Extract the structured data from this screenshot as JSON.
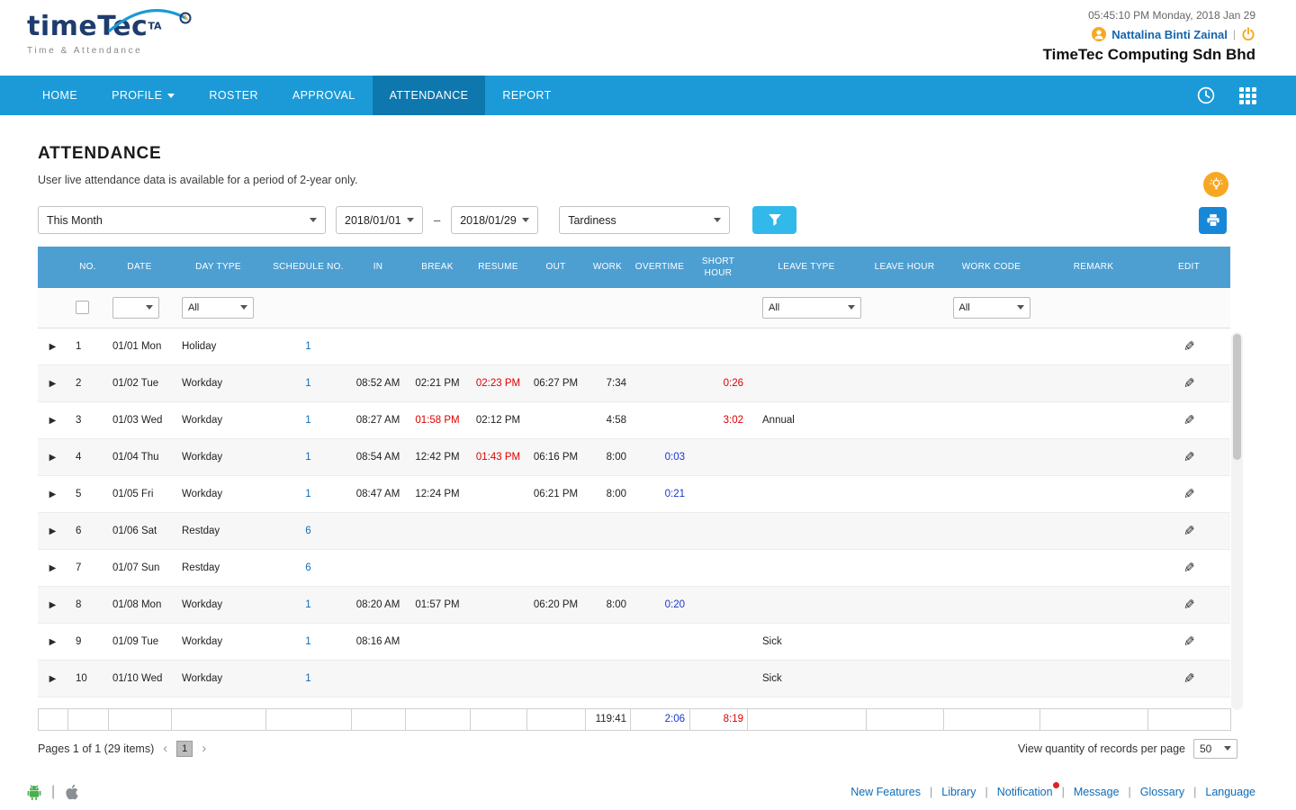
{
  "header": {
    "logo": {
      "brand": "timeTec",
      "suffix": "TA",
      "tagline": "Time & Attendance"
    },
    "datetime": "05:45:10 PM Monday, 2018 Jan 29",
    "user_name": "Nattalina Binti Zainal",
    "company": "TimeTec Computing Sdn Bhd"
  },
  "nav": {
    "home": "HOME",
    "profile": "PROFILE",
    "roster": "ROSTER",
    "approval": "APPROVAL",
    "attendance": "ATTENDANCE",
    "report": "REPORT"
  },
  "page": {
    "title": "ATTENDANCE",
    "subtitle": "User live attendance data is available for a period of 2-year only."
  },
  "filters": {
    "period": "This Month",
    "date_from": "2018/01/01",
    "range_dash": "–",
    "date_to": "2018/01/29",
    "type": "Tardiness"
  },
  "table": {
    "columns": [
      {
        "key": "no",
        "label": "NO."
      },
      {
        "key": "date",
        "label": "DATE"
      },
      {
        "key": "day_type",
        "label": "DAY TYPE"
      },
      {
        "key": "schedule_no",
        "label": "SCHEDULE NO."
      },
      {
        "key": "in",
        "label": "IN"
      },
      {
        "key": "break",
        "label": "BREAK"
      },
      {
        "key": "resume",
        "label": "RESUME"
      },
      {
        "key": "out",
        "label": "OUT"
      },
      {
        "key": "work",
        "label": "WORK"
      },
      {
        "key": "overtime",
        "label": "OVERTIME"
      },
      {
        "key": "short_hour",
        "label": "SHORT HOUR"
      },
      {
        "key": "leave_type",
        "label": "LEAVE TYPE"
      },
      {
        "key": "leave_hour",
        "label": "LEAVE HOUR"
      },
      {
        "key": "work_code",
        "label": "WORK CODE"
      },
      {
        "key": "remark",
        "label": "REMARK"
      },
      {
        "key": "edit",
        "label": "EDIT"
      }
    ],
    "filter_row": {
      "day_type": "All",
      "leave_type": "All",
      "work_code": "All"
    },
    "rows": [
      {
        "no": "1",
        "date": "01/01 Mon",
        "day_type": "Holiday",
        "schedule_no": {
          "v": "1",
          "c": "link"
        }
      },
      {
        "no": "2",
        "date": "01/02 Tue",
        "day_type": "Workday",
        "schedule_no": {
          "v": "1",
          "c": "link"
        },
        "in": "08:52 AM",
        "break": "02:21 PM",
        "resume": {
          "v": "02:23 PM",
          "c": "red"
        },
        "out": "06:27 PM",
        "work": "7:34",
        "short_hour": {
          "v": "0:26",
          "c": "red"
        }
      },
      {
        "no": "3",
        "date": "01/03 Wed",
        "day_type": "Workday",
        "schedule_no": {
          "v": "1",
          "c": "link"
        },
        "in": "08:27 AM",
        "break": {
          "v": "01:58 PM",
          "c": "red"
        },
        "resume": "02:12 PM",
        "work": "4:58",
        "short_hour": {
          "v": "3:02",
          "c": "red"
        },
        "leave_type": "Annual"
      },
      {
        "no": "4",
        "date": "01/04 Thu",
        "day_type": "Workday",
        "schedule_no": {
          "v": "1",
          "c": "link"
        },
        "in": "08:54 AM",
        "break": "12:42 PM",
        "resume": {
          "v": "01:43 PM",
          "c": "red"
        },
        "out": "06:16 PM",
        "work": "8:00",
        "overtime": {
          "v": "0:03",
          "c": "blue"
        }
      },
      {
        "no": "5",
        "date": "01/05 Fri",
        "day_type": "Workday",
        "schedule_no": {
          "v": "1",
          "c": "link"
        },
        "in": "08:47 AM",
        "break": "12:24 PM",
        "out": "06:21 PM",
        "work": "8:00",
        "overtime": {
          "v": "0:21",
          "c": "blue"
        }
      },
      {
        "no": "6",
        "date": "01/06 Sat",
        "day_type": "Restday",
        "schedule_no": {
          "v": "6",
          "c": "link"
        }
      },
      {
        "no": "7",
        "date": "01/07 Sun",
        "day_type": "Restday",
        "schedule_no": {
          "v": "6",
          "c": "link"
        }
      },
      {
        "no": "8",
        "date": "01/08 Mon",
        "day_type": "Workday",
        "schedule_no": {
          "v": "1",
          "c": "link"
        },
        "in": "08:20 AM",
        "break": "01:57 PM",
        "out": "06:20 PM",
        "work": "8:00",
        "overtime": {
          "v": "0:20",
          "c": "blue"
        }
      },
      {
        "no": "9",
        "date": "01/09 Tue",
        "day_type": "Workday",
        "schedule_no": {
          "v": "1",
          "c": "link"
        },
        "in": "08:16 AM",
        "leave_type": "Sick"
      },
      {
        "no": "10",
        "date": "01/10 Wed",
        "day_type": "Workday",
        "schedule_no": {
          "v": "1",
          "c": "link"
        },
        "leave_type": "Sick"
      }
    ],
    "totals": {
      "work": "119:41",
      "overtime": "2:06",
      "short_hour": "8:19"
    }
  },
  "pagination": {
    "summary": "Pages 1 of 1 (29 items)",
    "page": "1",
    "records_label": "View quantity of records per page",
    "records_value": "50"
  },
  "footer": {
    "links": [
      "New Features",
      "Library",
      "Notification",
      "Message",
      "Glossary",
      "Language"
    ]
  }
}
